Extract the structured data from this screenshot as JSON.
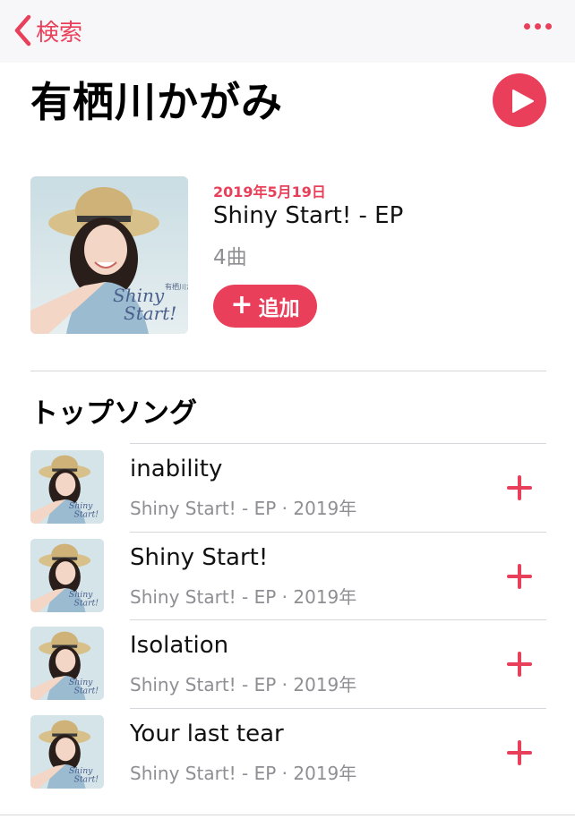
{
  "navbar": {
    "back_label": "検索",
    "back_icon": "chevron-left-icon",
    "more_icon": "ellipsis-icon",
    "accent_color": "#e8405a"
  },
  "artist": {
    "name": "有栖川かがみ",
    "play_icon": "play-icon"
  },
  "latest_release": {
    "date": "2019年5月19日",
    "title": "Shiny Start! - EP",
    "track_count": "4曲",
    "add_label": "追加",
    "art_text_artist": "有栖川かがみ",
    "art_text_title_1": "Shiny",
    "art_text_title_2": "Start!"
  },
  "top_songs": {
    "heading": "トップソング",
    "items": [
      {
        "title": "inability",
        "subtitle": "Shiny Start! - EP · 2019年"
      },
      {
        "title": "Shiny Start!",
        "subtitle": "Shiny Start! - EP · 2019年"
      },
      {
        "title": "Isolation",
        "subtitle": "Shiny Start! - EP · 2019年"
      },
      {
        "title": "Your last tear",
        "subtitle": "Shiny Start! - EP · 2019年"
      }
    ]
  }
}
